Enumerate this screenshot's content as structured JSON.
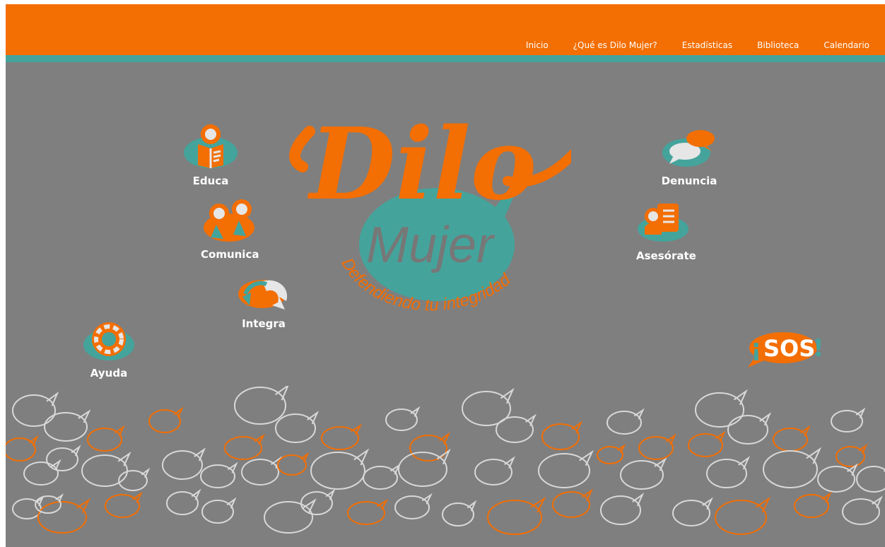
{
  "nav": {
    "items": [
      {
        "label": "Inicio"
      },
      {
        "label": "¿Qué es Dilo Mujer?"
      },
      {
        "label": "Estadísticas"
      },
      {
        "label": "Biblioteca"
      },
      {
        "label": "Calendario"
      }
    ]
  },
  "logo": {
    "main": "Dilo",
    "sub": "Mujer",
    "tagline": "Defendiendo tu integridad"
  },
  "features": {
    "educa": {
      "label": "Educa",
      "icon": "reading-person-icon"
    },
    "comunica": {
      "label": "Comunica",
      "icon": "two-people-icon"
    },
    "integra": {
      "label": "Integra",
      "icon": "cycle-arrows-icon"
    },
    "ayuda": {
      "label": "Ayuda",
      "icon": "lifebuoy-icon"
    },
    "denuncia": {
      "label": "Denuncia",
      "icon": "speech-bubbles-icon"
    },
    "asesorate": {
      "label": "Asesórate",
      "icon": "person-document-icon"
    }
  },
  "sos": {
    "label": "SOS",
    "prefix": "¡",
    "suffix": "!"
  },
  "colors": {
    "orange": "#f36e03",
    "teal": "#44a49c",
    "gray": "#7f7f7f",
    "light": "#d8d8d8"
  }
}
